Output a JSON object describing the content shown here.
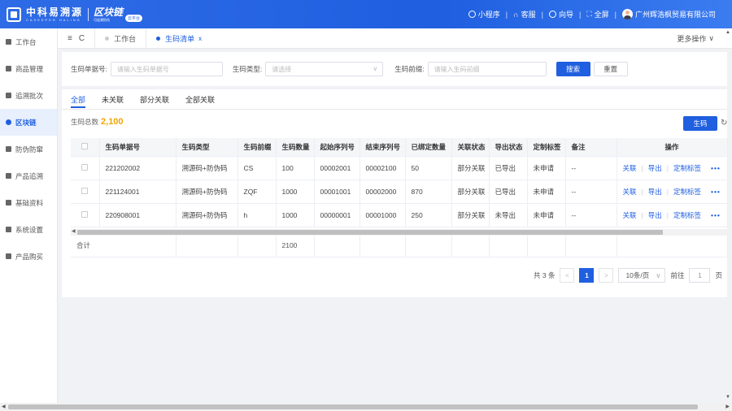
{
  "header": {
    "logo_cn": "中科易溯源",
    "logo_en": "CASEEPER HALING",
    "chain_cn": "区块链",
    "chain_sub": "可追溯防伪",
    "chain_badge": "云平台",
    "mini_program": "小程序",
    "customer_service": "客服",
    "guide": "向导",
    "fullscreen": "全屏",
    "company": "广州辉浩枫贸易有限公司"
  },
  "sidebar": {
    "items": [
      {
        "label": "工作台",
        "icon": "workbench-icon"
      },
      {
        "label": "商品管理",
        "icon": "product-icon"
      },
      {
        "label": "追溯批次",
        "icon": "batch-icon"
      },
      {
        "label": "区块链",
        "icon": "blockchain-icon"
      },
      {
        "label": "防伪防窜",
        "icon": "anticounterfeit-icon"
      },
      {
        "label": "产品追溯",
        "icon": "trace-icon"
      },
      {
        "label": "基础资料",
        "icon": "basic-data-icon"
      },
      {
        "label": "系统设置",
        "icon": "settings-icon"
      },
      {
        "label": "产品购买",
        "icon": "purchase-icon"
      }
    ],
    "active_index": 3
  },
  "tabsbar": {
    "controls": [
      "≡",
      "C"
    ],
    "tabs": [
      {
        "label": "工作台",
        "active": false
      },
      {
        "label": "生码清单",
        "active": true,
        "close": "x"
      }
    ],
    "more_ops": "更多操作"
  },
  "search": {
    "order_label": "生码单据号:",
    "order_placeholder": "请输入生码单据号",
    "type_label": "生码类型:",
    "type_placeholder": "请选择",
    "prefix_label": "生码前缀:",
    "prefix_placeholder": "请输入生码前缀",
    "search_btn": "搜索",
    "reset_btn": "重置"
  },
  "filter_tabs": [
    "全部",
    "未关联",
    "部分关联",
    "全部关联"
  ],
  "summary": {
    "label": "生码总数",
    "value": "2,100",
    "generate_btn": "生码"
  },
  "table": {
    "columns": [
      "生码单据号",
      "生码类型",
      "生码前缀",
      "生码数量",
      "起始序列号",
      "结束序列号",
      "已绑定数量",
      "关联状态",
      "导出状态",
      "定制标签",
      "备注",
      "操作"
    ],
    "rows": [
      {
        "order": "221202002",
        "type": "溯源码+防伪码",
        "prefix": "CS",
        "qty": "100",
        "start": "00002001",
        "end": "00002100",
        "bound": "50",
        "link": "部分关联",
        "export": "已导出",
        "tag": "未申请",
        "note": "--"
      },
      {
        "order": "221124001",
        "type": "溯源码+防伪码",
        "prefix": "ZQF",
        "qty": "1000",
        "start": "00001001",
        "end": "00002000",
        "bound": "870",
        "link": "部分关联",
        "export": "已导出",
        "tag": "未申请",
        "note": "--"
      },
      {
        "order": "220908001",
        "type": "溯源码+防伪码",
        "prefix": "h",
        "qty": "1000",
        "start": "00000001",
        "end": "00001000",
        "bound": "250",
        "link": "部分关联",
        "export": "未导出",
        "tag": "未申请",
        "note": "--"
      }
    ],
    "ops": [
      "关联",
      "导出",
      "定制标签",
      "•••"
    ],
    "sum_label": "合计",
    "sum_qty": "2100"
  },
  "pager": {
    "total": "共 3 条",
    "current": "1",
    "page_size": "10条/页",
    "goto_label": "前往",
    "goto_value": "1",
    "page_suffix": "页"
  }
}
